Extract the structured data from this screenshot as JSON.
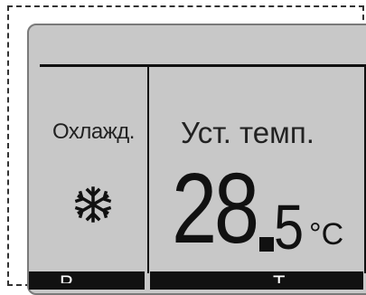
{
  "mode": {
    "label": "Охлажд.",
    "icon": "snowflake-icon"
  },
  "setpoint": {
    "label": "Уст. темп.",
    "whole": "28",
    "fraction": "5",
    "unit": "°C"
  },
  "soft_keys": [
    "Р",
    "Т"
  ]
}
